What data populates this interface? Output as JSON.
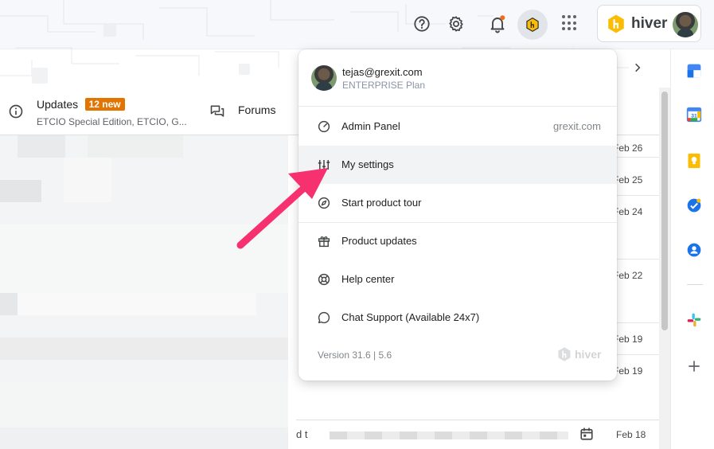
{
  "brand": {
    "name": "hiver",
    "color": "#fbbc04"
  },
  "topbar": {
    "icons": [
      "help-icon",
      "settings-gear-icon",
      "notifications-bell-icon",
      "hiver-extension-icon",
      "apps-grid-icon"
    ]
  },
  "tabs": {
    "updates": {
      "label": "Updates",
      "badge": "12 new",
      "badge_color": "#e37400",
      "subtitle": "ETCIO Special Edition, ETCIO, G..."
    },
    "forums": {
      "label": "Forums"
    }
  },
  "rows": {
    "dates": [
      "Feb 26",
      "Feb 25",
      "Feb 24",
      "Feb 22",
      "Feb 19",
      "Feb 19"
    ],
    "bottom": {
      "text": "d t",
      "date": "Feb 18"
    }
  },
  "menu": {
    "email": "tejas@grexit.com",
    "plan": "ENTERPRISE Plan",
    "items": [
      {
        "label": "Admin Panel",
        "right": "grexit.com"
      },
      {
        "label": "My settings"
      },
      {
        "label": "Start product tour"
      },
      {
        "label": "Product updates"
      },
      {
        "label": "Help center"
      },
      {
        "label": "Chat Support (Available 24x7)"
      }
    ],
    "version": "Version 31.6 | 5.6",
    "footer_logo": "hiver"
  },
  "annotation": {
    "arrow_color": "#f7306f"
  },
  "side_panel": {
    "icons": [
      "tasks-icon",
      "calendar-icon",
      "keep-icon",
      "google-tasks-icon",
      "contacts-icon",
      "slack-icon",
      "add-icon"
    ]
  }
}
